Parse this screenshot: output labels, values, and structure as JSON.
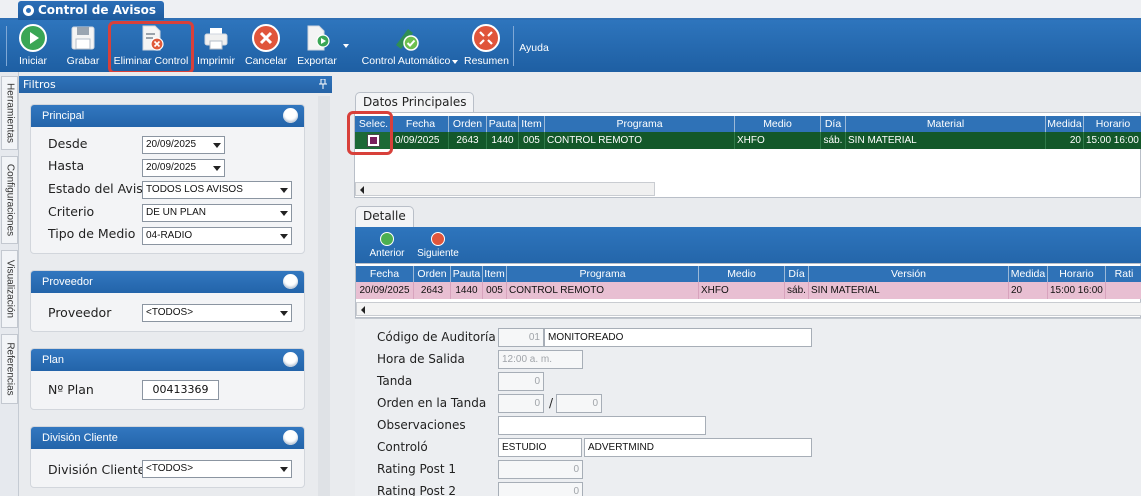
{
  "tab": {
    "title": "Control de Avisos"
  },
  "toolbar": {
    "iniciar": "Iniciar",
    "grabar": "Grabar",
    "eliminar": "Eliminar Control",
    "imprimir": "Imprimir",
    "cancelar": "Cancelar",
    "exportar": "Exportar",
    "control_automatico": "Control Automático",
    "resumen": "Resumen",
    "ayuda": "Ayuda"
  },
  "vtabs": [
    "Herramientas",
    "Configuraciones",
    "Visualización",
    "Referencias"
  ],
  "filters": {
    "header": "Filtros",
    "principal": {
      "title": "Principal",
      "desde_label": "Desde",
      "desde_value": "20/09/2025",
      "hasta_label": "Hasta",
      "hasta_value": "20/09/2025",
      "estado_label": "Estado del Aviso",
      "estado_value": "TODOS LOS AVISOS",
      "criterio_label": "Criterio",
      "criterio_value": "DE UN PLAN",
      "tipo_label": "Tipo de Medio",
      "tipo_value": "04-RADIO"
    },
    "proveedor": {
      "title": "Proveedor",
      "label": "Proveedor",
      "value": "<TODOS>"
    },
    "plan": {
      "title": "Plan",
      "label": "Nº Plan",
      "value": "00413369"
    },
    "division": {
      "title": "División Cliente",
      "label": "División Cliente",
      "value": "<TODOS>"
    }
  },
  "datos": {
    "tab": "Datos Principales",
    "columns": [
      "Selec.",
      "Fecha",
      "Orden",
      "Pauta",
      "Item",
      "Programa",
      "Medio",
      "Día",
      "Material",
      "Medida",
      "Horario"
    ],
    "row": [
      "",
      "0/09/2025",
      "2643",
      "1440",
      "005",
      "CONTROL REMOTO",
      "XHFO",
      "sáb.",
      "SIN MATERIAL",
      "20",
      "15:00 16:00"
    ]
  },
  "detalle": {
    "tab": "Detalle",
    "anterior": "Anterior",
    "siguiente": "Siguiente",
    "columns": [
      "Fecha",
      "Orden",
      "Pauta",
      "Item",
      "Programa",
      "Medio",
      "Día",
      "Versión",
      "Medida",
      "Horario",
      "Rati"
    ],
    "row": [
      "20/09/2025",
      "2643",
      "1440",
      "005",
      "CONTROL REMOTO",
      "XHFO",
      "sáb.",
      "SIN MATERIAL",
      "20",
      "15:00 16:00",
      ""
    ]
  },
  "form": {
    "codigo_label": "Código de Auditoría",
    "codigo_num": "01",
    "codigo_text": "MONITOREADO",
    "hora_label": "Hora de Salida",
    "hora_value": "12:00 a. m.",
    "tanda_label": "Tanda",
    "tanda_value": "0",
    "orden_label": "Orden en la Tanda",
    "orden_value1": "0",
    "orden_sep": "/",
    "orden_value2": "0",
    "obs_label": "Observaciones",
    "obs_value": "",
    "controlo_label": "Controló",
    "controlo_value1": "ESTUDIO",
    "controlo_value2": "ADVERTMIND",
    "rating1_label": "Rating Post 1",
    "rating1_value": "0",
    "rating2_label": "Rating Post 2",
    "rating2_value": "0"
  }
}
